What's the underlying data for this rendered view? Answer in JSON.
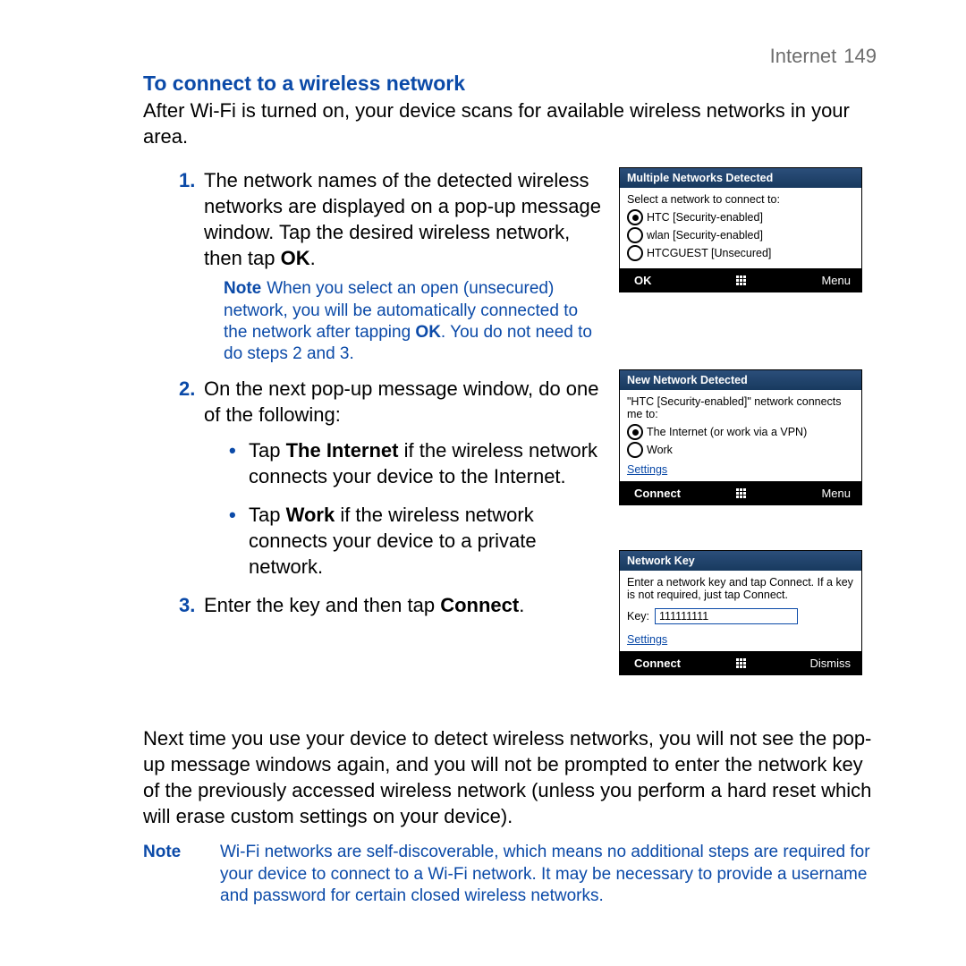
{
  "header": {
    "section": "Internet",
    "page": "149"
  },
  "title": "To connect to a wireless network",
  "intro": "After Wi-Fi is turned on, your device scans for available wireless networks in your area.",
  "steps": {
    "s1": {
      "num": "1.",
      "text_a": "The network names of the detected wireless networks are displayed on a pop-up message window. Tap the desired wireless network, then tap ",
      "bold": "OK",
      "text_b": ".",
      "note": {
        "label": "Note",
        "text_a": "When you select an open (unsecured) network, you will be automatically connected to the network after tapping ",
        "bold": "OK",
        "text_b": ". You do not need to do steps 2 and 3."
      }
    },
    "s2": {
      "num": "2.",
      "text": "On the next pop-up message window, do one of the following:",
      "b1_a": "Tap ",
      "b1_bold": "The Internet",
      "b1_b": " if the wireless network connects your device to the Internet.",
      "b2_a": "Tap ",
      "b2_bold": "Work",
      "b2_b": " if the wireless network connects your device to a private network."
    },
    "s3": {
      "num": "3.",
      "text_a": "Enter the key and then tap ",
      "bold": "Connect",
      "text_b": "."
    }
  },
  "after": "Next time you use your device to detect wireless networks, you will not see the pop-up message windows again, and you will not be prompted to enter the network key of the previously accessed wireless network (unless you perform a hard reset which will erase custom settings on your device).",
  "footer_note": {
    "label": "Note",
    "text": "Wi-Fi networks are self-discoverable, which means no additional steps are required for your device to connect to a Wi-Fi network. It may be necessary to provide a username and password for certain closed wireless networks."
  },
  "dialog1": {
    "title": "Multiple Networks Detected",
    "prompt": "Select a network to connect to:",
    "options": [
      "HTC [Security-enabled]",
      "wlan [Security-enabled]",
      "HTCGUEST [Unsecured]"
    ],
    "sk_left": "OK",
    "sk_right": "Menu"
  },
  "dialog2": {
    "title": "New Network Detected",
    "prompt": "\"HTC [Security-enabled]\" network connects me to:",
    "options": [
      "The Internet (or work via a VPN)",
      "Work"
    ],
    "settings": "Settings",
    "sk_left": "Connect",
    "sk_right": "Menu"
  },
  "dialog3": {
    "title": "Network Key",
    "prompt": "Enter a network key and tap Connect. If a key is not required, just tap Connect.",
    "key_label": "Key:",
    "key_value": "111111111",
    "settings": "Settings",
    "sk_left": "Connect",
    "sk_right": "Dismiss"
  }
}
